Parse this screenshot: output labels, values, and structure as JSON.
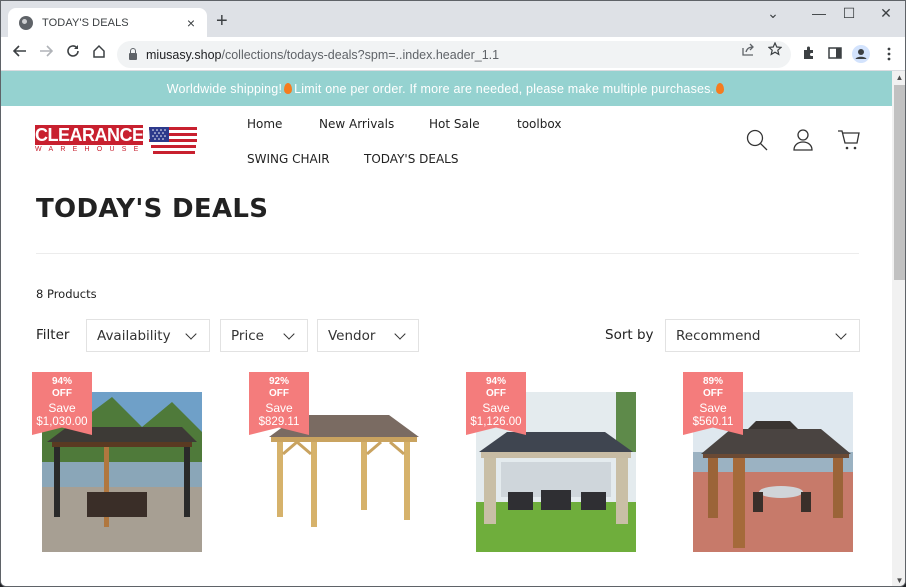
{
  "browser": {
    "tab_title": "TODAY'S DEALS",
    "tab_close": "×",
    "new_tab": "+",
    "window_controls": {
      "dropdown": "⌄",
      "minimize": "—",
      "maximize": "☐",
      "close": "✕"
    },
    "url_host": "miusasy.shop",
    "url_path": "/collections/todays-deals?spm=..index.header_1.1"
  },
  "announcement": {
    "part1": "Worldwide shipping!",
    "part2": "Limit one per order. If more are needed, please make multiple purchases."
  },
  "header": {
    "logo_main": "CLEARANCE",
    "logo_sub": "WAREHOUSE",
    "nav": [
      {
        "label": "Home"
      },
      {
        "label": "New Arrivals"
      },
      {
        "label": "Hot Sale"
      },
      {
        "label": "toolbox"
      },
      {
        "label": "SWING CHAIR"
      },
      {
        "label": "TODAY'S DEALS"
      }
    ],
    "icons": [
      "search-icon",
      "account-icon",
      "cart-icon"
    ]
  },
  "collection": {
    "title": "TODAY'S DEALS",
    "product_count": "8 Products",
    "filter_label": "Filter",
    "filters": [
      {
        "label": "Availability"
      },
      {
        "label": "Price"
      },
      {
        "label": "Vendor"
      }
    ],
    "sort_label": "Sort by",
    "sort_value": "Recommend"
  },
  "products": [
    {
      "discount": "94%",
      "off": "OFF",
      "save_label": "Save",
      "save_amount": "$1,030.00",
      "image": "gazebo-dark-roof-netting-patio"
    },
    {
      "discount": "92%",
      "off": "OFF",
      "save_label": "Save",
      "save_amount": "$829.11",
      "image": "gazebo-wood-frame-white-bg"
    },
    {
      "discount": "94%",
      "off": "OFF",
      "save_label": "Save",
      "save_amount": "$1,126.00",
      "image": "gazebo-beige-curtains-lawn"
    },
    {
      "discount": "89%",
      "off": "OFF",
      "save_label": "Save",
      "save_amount": "$560.11",
      "image": "gazebo-double-roof-deck"
    }
  ],
  "colors": {
    "announcement_bg": "#95d2d0",
    "badge_bg": "#f47c7c",
    "logo_red": "#c8202f"
  }
}
